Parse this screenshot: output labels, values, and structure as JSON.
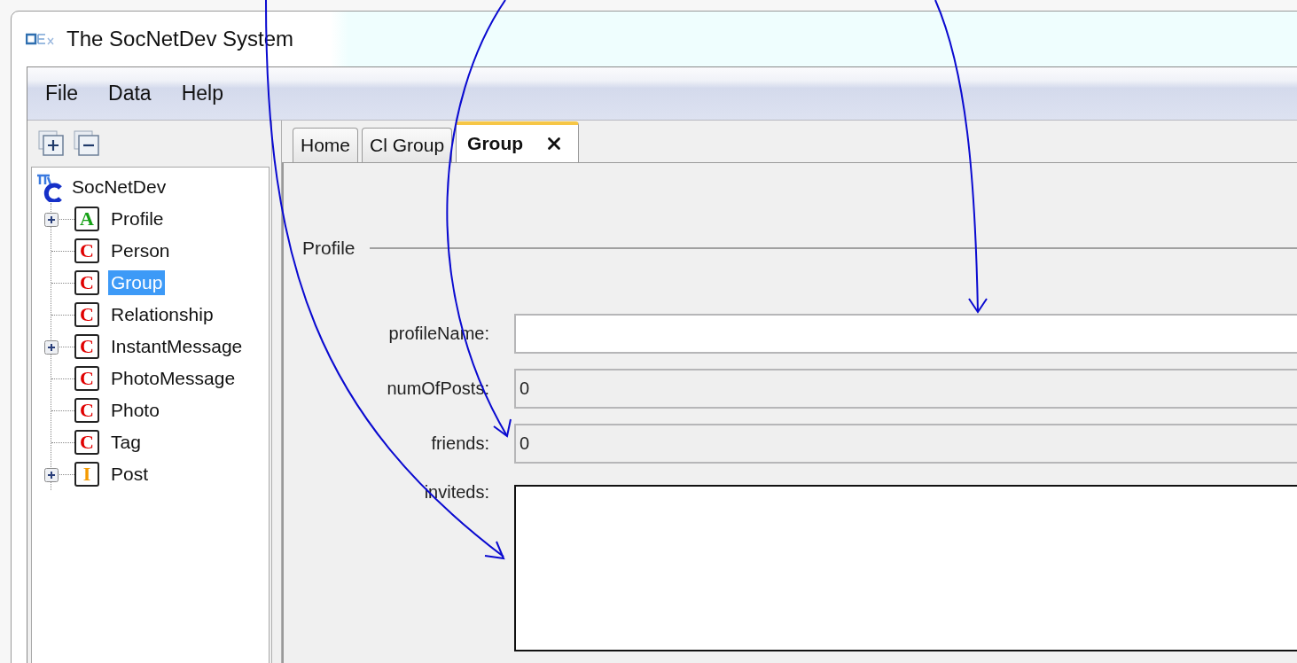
{
  "window": {
    "title": "The SocNetDev System"
  },
  "menu": [
    "File",
    "Data",
    "Help"
  ],
  "tree": {
    "root": "SocNetDev",
    "children": [
      {
        "label": "Profile",
        "badge": "A",
        "kind": "attribute",
        "expandable": true,
        "selected": false
      },
      {
        "label": "Person",
        "badge": "C",
        "kind": "class",
        "expandable": false,
        "selected": false
      },
      {
        "label": "Group",
        "badge": "C",
        "kind": "class",
        "expandable": false,
        "selected": true
      },
      {
        "label": "Relationship",
        "badge": "C",
        "kind": "class",
        "expandable": false,
        "selected": false
      },
      {
        "label": "InstantMessage",
        "badge": "C",
        "kind": "class",
        "expandable": true,
        "selected": false
      },
      {
        "label": "PhotoMessage",
        "badge": "C",
        "kind": "class",
        "expandable": false,
        "selected": false
      },
      {
        "label": "Photo",
        "badge": "C",
        "kind": "class",
        "expandable": false,
        "selected": false
      },
      {
        "label": "Tag",
        "badge": "C",
        "kind": "class",
        "expandable": false,
        "selected": false
      },
      {
        "label": "Post",
        "badge": "I",
        "kind": "interface",
        "expandable": true,
        "selected": false
      }
    ]
  },
  "tabs": [
    {
      "label": "Home",
      "selected": false,
      "closable": false
    },
    {
      "label": "Cl Group",
      "selected": false,
      "closable": false
    },
    {
      "label": "Group",
      "selected": true,
      "closable": true
    }
  ],
  "form": {
    "section": "Profile",
    "fields": [
      {
        "label": "profileName:",
        "kind": "text"
      },
      {
        "label": "numOfPosts:",
        "kind": "readonly",
        "value": "0"
      },
      {
        "label": "friends:",
        "kind": "readonly",
        "value": "0"
      },
      {
        "label": "inviteds:",
        "kind": "list"
      }
    ]
  }
}
